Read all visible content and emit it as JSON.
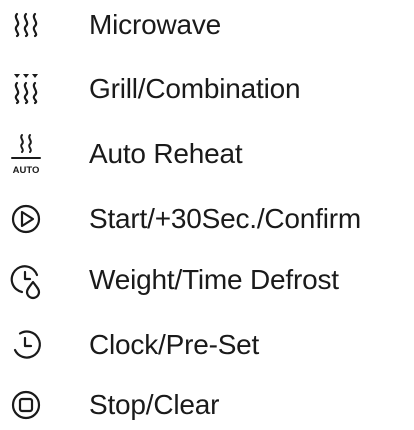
{
  "colors": {
    "text": "#1a1a1a",
    "icon": "#1a1a1a",
    "background": "#ffffff"
  },
  "items": [
    {
      "icon": "microwave-waves-icon",
      "label": "Microwave"
    },
    {
      "icon": "grill-combination-icon",
      "label": "Grill/Combination"
    },
    {
      "icon": "auto-reheat-icon",
      "label": "Auto Reheat",
      "icon_text": "AUTO"
    },
    {
      "icon": "play-circle-icon",
      "label": "Start/+30Sec./Confirm"
    },
    {
      "icon": "defrost-clock-drop-icon",
      "label": "Weight/Time Defrost"
    },
    {
      "icon": "clock-icon",
      "label": "Clock/Pre-Set"
    },
    {
      "icon": "stop-square-circle-icon",
      "label": "Stop/Clear"
    }
  ]
}
